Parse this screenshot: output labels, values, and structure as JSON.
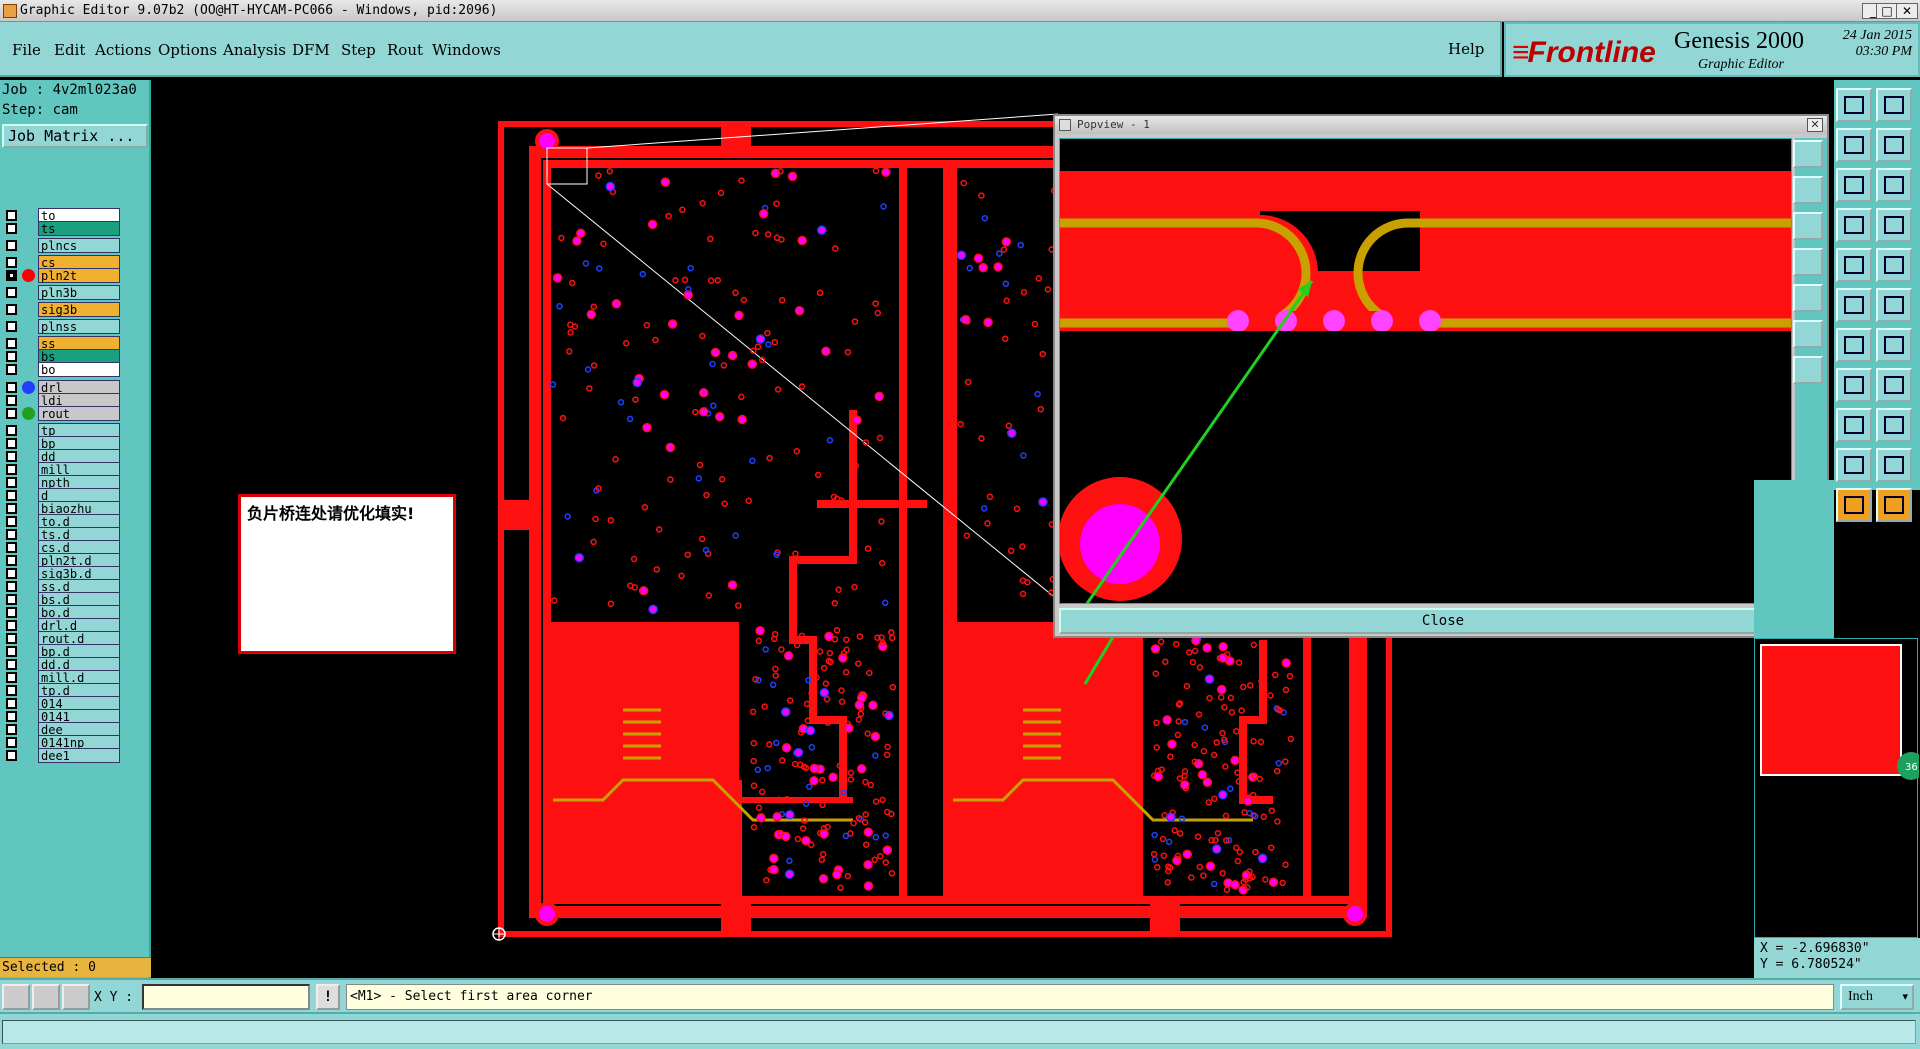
{
  "window": {
    "title": "Graphic Editor 9.07b2 (OO@HT-HYCAM-PC066 - Windows, pid:2096)",
    "controls": [
      "_",
      "□",
      "✕"
    ]
  },
  "menu": {
    "items": [
      "File",
      "Edit",
      "Actions",
      "Options",
      "Analysis",
      "DFM",
      "Step",
      "Rout",
      "Windows"
    ],
    "help": "Help"
  },
  "brand": {
    "logo": "Frontline",
    "product": "Genesis 2000",
    "subtitle": "Graphic Editor",
    "date": "24 Jan 2015",
    "time": "03:30 PM"
  },
  "job": {
    "job_label": "Job : 4v2ml023a0",
    "step_label": "Step: cam",
    "matrix_button": "Job Matrix ...",
    "selected": "Selected : 0"
  },
  "layers": [
    {
      "name": "to",
      "bg": "#ffffff",
      "check": "off",
      "dot": ""
    },
    {
      "name": "ts",
      "bg": "#1aa080",
      "check": "off",
      "dot": ""
    },
    {
      "name": "plncs",
      "bg": "#93d6d6",
      "check": "off",
      "dot": ""
    },
    {
      "name": "cs",
      "bg": "#f0b030",
      "check": "off",
      "dot": ""
    },
    {
      "name": "pln2t",
      "bg": "#f0b030",
      "check": "on",
      "dot": "#ff0000"
    },
    {
      "name": "pln3b",
      "bg": "#93d6d6",
      "check": "off",
      "dot": ""
    },
    {
      "name": "sig3b",
      "bg": "#f0b030",
      "check": "off",
      "dot": ""
    },
    {
      "name": "plnss",
      "bg": "#93d6d6",
      "check": "off",
      "dot": ""
    },
    {
      "name": "ss",
      "bg": "#f0b030",
      "check": "off",
      "dot": ""
    },
    {
      "name": "bs",
      "bg": "#1aa080",
      "check": "off",
      "dot": ""
    },
    {
      "name": "bo",
      "bg": "#ffffff",
      "check": "off",
      "dot": ""
    },
    {
      "name": "drl",
      "bg": "#c8c8c8",
      "check": "off",
      "dot": "#2040ff"
    },
    {
      "name": "ldi",
      "bg": "#c8c8c8",
      "check": "off",
      "dot": ""
    },
    {
      "name": "rout",
      "bg": "#c8c8c8",
      "check": "off",
      "dot": "#20a020"
    },
    {
      "name": "tp",
      "bg": "#93d6d6",
      "check": "off",
      "dot": ""
    },
    {
      "name": "bp",
      "bg": "#93d6d6",
      "check": "off",
      "dot": ""
    },
    {
      "name": "dd",
      "bg": "#93d6d6",
      "check": "off",
      "dot": ""
    },
    {
      "name": "mill",
      "bg": "#93d6d6",
      "check": "off",
      "dot": ""
    },
    {
      "name": "npth",
      "bg": "#93d6d6",
      "check": "off",
      "dot": ""
    },
    {
      "name": "d",
      "bg": "#93d6d6",
      "check": "off",
      "dot": ""
    },
    {
      "name": "biaozhu",
      "bg": "#93d6d6",
      "check": "off",
      "dot": ""
    },
    {
      "name": "to.d",
      "bg": "#93d6d6",
      "check": "off",
      "dot": ""
    },
    {
      "name": "ts.d",
      "bg": "#93d6d6",
      "check": "off",
      "dot": ""
    },
    {
      "name": "cs.d",
      "bg": "#93d6d6",
      "check": "off",
      "dot": ""
    },
    {
      "name": "pln2t.d",
      "bg": "#93d6d6",
      "check": "off",
      "dot": ""
    },
    {
      "name": "sig3b.d",
      "bg": "#93d6d6",
      "check": "off",
      "dot": ""
    },
    {
      "name": "ss.d",
      "bg": "#93d6d6",
      "check": "off",
      "dot": ""
    },
    {
      "name": "bs.d",
      "bg": "#93d6d6",
      "check": "off",
      "dot": ""
    },
    {
      "name": "bo.d",
      "bg": "#93d6d6",
      "check": "off",
      "dot": ""
    },
    {
      "name": "drl.d",
      "bg": "#93d6d6",
      "check": "off",
      "dot": ""
    },
    {
      "name": "rout.d",
      "bg": "#93d6d6",
      "check": "off",
      "dot": ""
    },
    {
      "name": "bp.d",
      "bg": "#93d6d6",
      "check": "off",
      "dot": ""
    },
    {
      "name": "dd.d",
      "bg": "#93d6d6",
      "check": "off",
      "dot": ""
    },
    {
      "name": "mill.d",
      "bg": "#93d6d6",
      "check": "off",
      "dot": ""
    },
    {
      "name": "tp.d",
      "bg": "#93d6d6",
      "check": "off",
      "dot": ""
    },
    {
      "name": "014",
      "bg": "#93d6d6",
      "check": "off",
      "dot": ""
    },
    {
      "name": "0141",
      "bg": "#93d6d6",
      "check": "off",
      "dot": ""
    },
    {
      "name": "dee",
      "bg": "#93d6d6",
      "check": "off",
      "dot": ""
    },
    {
      "name": "0141np",
      "bg": "#93d6d6",
      "check": "off",
      "dot": ""
    },
    {
      "name": "dee1",
      "bg": "#93d6d6",
      "check": "off",
      "dot": ""
    }
  ],
  "note": {
    "text": "负片桥连处请优化填实!"
  },
  "popview": {
    "title": "Popview - 1",
    "close_button": "Close"
  },
  "coords": {
    "x": "X = -2.696830\"",
    "y": "Y = 6.780524\""
  },
  "minimap": {
    "zoom_badge": "36"
  },
  "status": {
    "xy_label": "X Y :",
    "xy_value": "",
    "prompt": "<M1> - Select first area corner",
    "units": "Inch"
  },
  "colors": {
    "copper": "#ff1010",
    "pad": "#ff00ff",
    "drill": "#2040ff",
    "rout": "#c8a000",
    "arrow": "#20c020",
    "panel": "#93d6d6"
  }
}
